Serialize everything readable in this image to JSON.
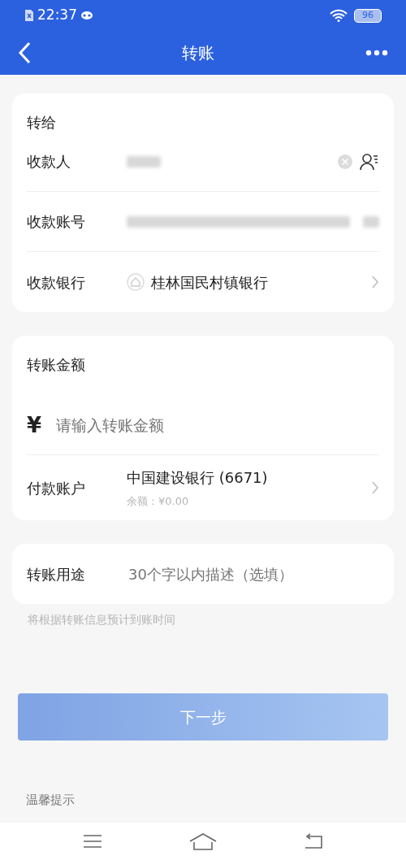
{
  "status_bar": {
    "time": "22:37",
    "battery": "96"
  },
  "header": {
    "title": "转账"
  },
  "recipient_card": {
    "title": "转给",
    "rows": [
      {
        "kind": "redacted",
        "label": "收款人",
        "clearable": true,
        "contacts": true
      },
      {
        "kind": "redacted",
        "label": "收款账号",
        "clearable": false,
        "contacts": false
      },
      {
        "kind": "bank",
        "label": "收款银行",
        "value": "桂林国民村镇银行"
      }
    ]
  },
  "amount_card": {
    "title": "转账金额",
    "currency": "¥",
    "placeholder": "请输入转账金额",
    "payer_label": "付款账户",
    "payer_account": "中国建设银行 (6671)",
    "balance": "余额：¥0.00"
  },
  "purpose": {
    "label": "转账用途",
    "placeholder": "30个字以内描述（选填）"
  },
  "hint": "将根据转账信息预计到账时间",
  "next_button": {
    "label": "下一步",
    "disabled": true
  },
  "tips_title": "温馨提示"
}
